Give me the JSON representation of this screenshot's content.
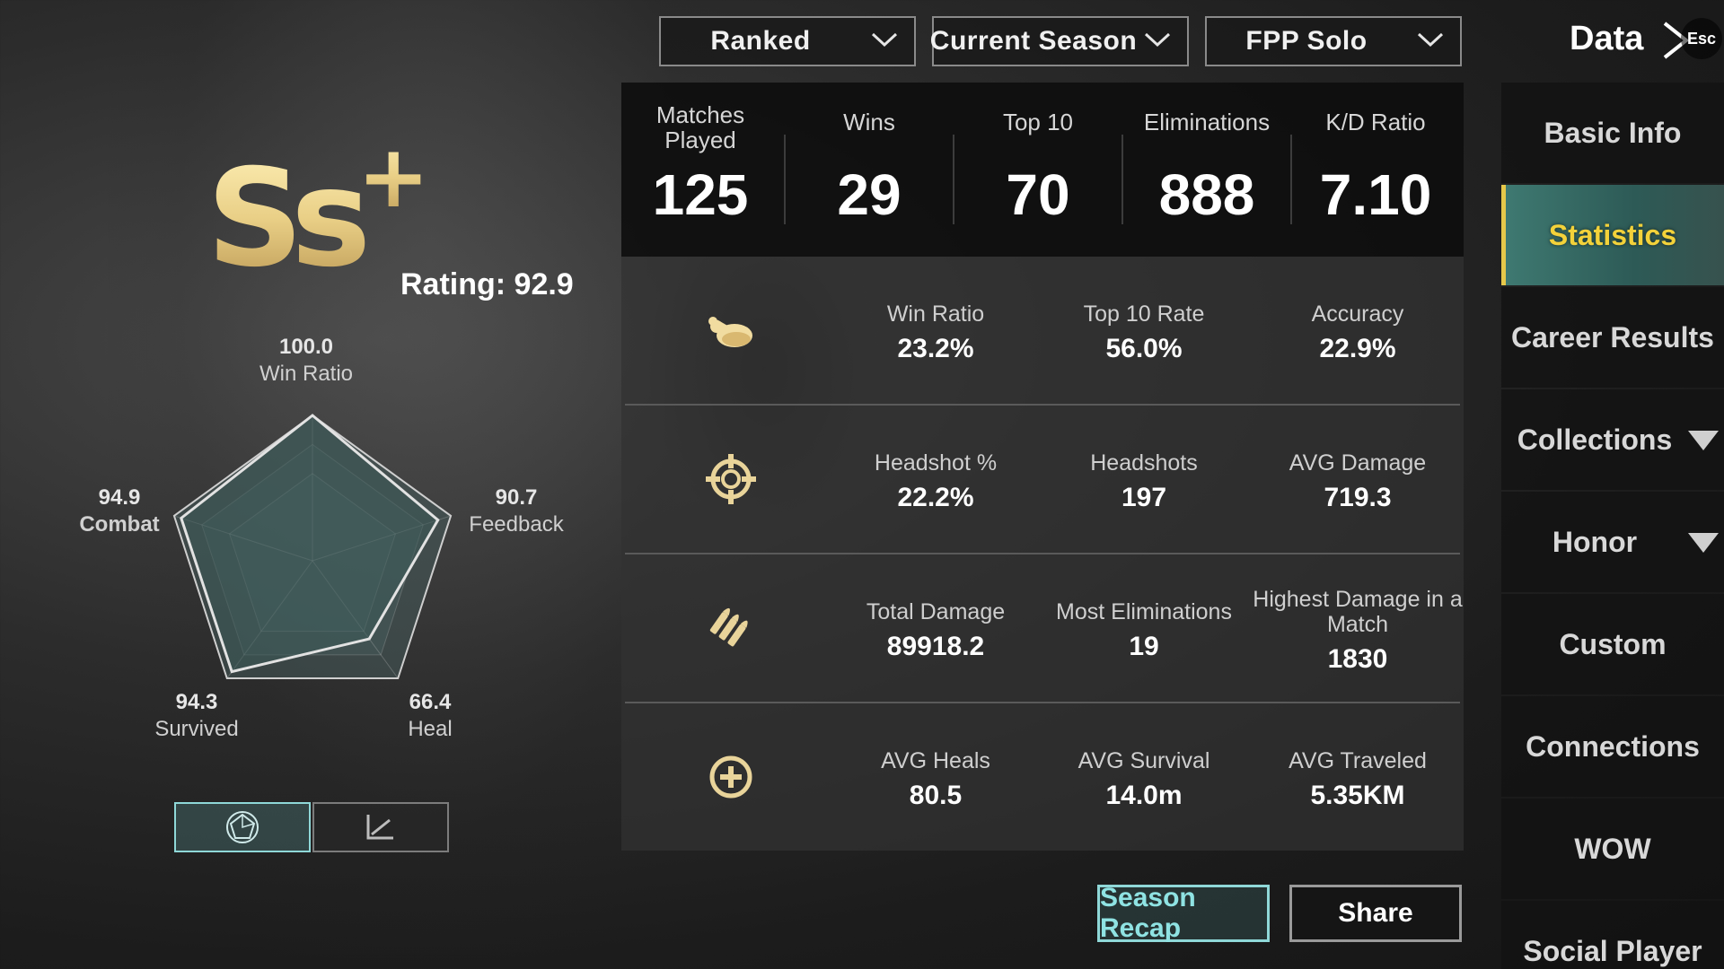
{
  "filters": {
    "mode": "Ranked",
    "season": "Current Season",
    "perspective": "FPP Solo"
  },
  "header": {
    "title": "Data",
    "esc": "Esc"
  },
  "rank": {
    "tier": "Ss+",
    "rating": "Rating: 92.9"
  },
  "radar": {
    "axes": [
      {
        "label": "Win Ratio",
        "value": "100.0",
        "score": 100.0
      },
      {
        "label": "Feedback",
        "value": "90.7",
        "score": 90.7
      },
      {
        "label": "Heal",
        "value": "66.4",
        "score": 66.4
      },
      {
        "label": "Survived",
        "value": "94.3",
        "score": 94.3
      },
      {
        "label": "Combat",
        "value": "94.9",
        "score": 94.9
      }
    ]
  },
  "overview": [
    {
      "label": "Matches\nPlayed",
      "value": "125"
    },
    {
      "label": "Wins",
      "value": "29"
    },
    {
      "label": "Top 10",
      "value": "70"
    },
    {
      "label": "Eliminations",
      "value": "888"
    },
    {
      "label": "K/D Ratio",
      "value": "7.10"
    }
  ],
  "rows": [
    {
      "icon": "chicken-icon",
      "stats": [
        {
          "label": "Win Ratio",
          "value": "23.2%"
        },
        {
          "label": "Top 10 Rate",
          "value": "56.0%"
        },
        {
          "label": "Accuracy",
          "value": "22.9%"
        }
      ]
    },
    {
      "icon": "crosshair-icon",
      "stats": [
        {
          "label": "Headshot %",
          "value": "22.2%"
        },
        {
          "label": "Headshots",
          "value": "197"
        },
        {
          "label": "AVG Damage",
          "value": "719.3"
        }
      ]
    },
    {
      "icon": "bullets-icon",
      "stats": [
        {
          "label": "Total Damage",
          "value": "89918.2"
        },
        {
          "label": "Most Eliminations",
          "value": "19"
        },
        {
          "label": "Highest Damage in a Match",
          "value": "1830"
        }
      ]
    },
    {
      "icon": "medkit-plus-icon",
      "stats": [
        {
          "label": "AVG Heals",
          "value": "80.5"
        },
        {
          "label": "AVG Survival",
          "value": "14.0m"
        },
        {
          "label": "AVG Traveled",
          "value": "5.35KM"
        }
      ]
    }
  ],
  "sidebar": {
    "items": [
      {
        "label": "Basic Info"
      },
      {
        "label": "Statistics",
        "active": true
      },
      {
        "label": "Career Results"
      },
      {
        "label": "Collections",
        "expandable": true
      },
      {
        "label": "Honor",
        "expandable": true
      },
      {
        "label": "Custom"
      },
      {
        "label": "Connections"
      },
      {
        "label": "WOW"
      },
      {
        "label": "Social Player"
      }
    ]
  },
  "buttons": {
    "recap": "Season Recap",
    "share": "Share"
  },
  "colors": {
    "accent": "#8fd8d8",
    "gold": "#e6c84a",
    "active_tab": "#3f7a72"
  }
}
